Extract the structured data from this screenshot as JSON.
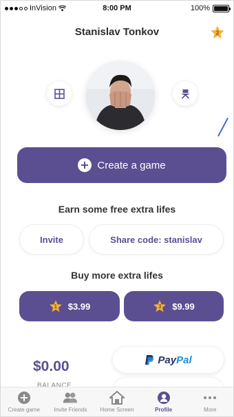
{
  "status_bar": {
    "carrier": "InVision",
    "time": "8:00 PM",
    "battery": "100%"
  },
  "header": {
    "title": "Stanislav Tonkov",
    "star_count": "2"
  },
  "actions": {
    "create_game_label": "Create a game"
  },
  "earn": {
    "title": "Earn some free extra lifes",
    "invite_label": "Invite",
    "share_code_label": "Share code: stanislav"
  },
  "buy": {
    "title": "Buy more extra lifes",
    "options": [
      {
        "badge": "1",
        "price": "$3.99"
      },
      {
        "badge": "3",
        "price": "$9.99"
      }
    ]
  },
  "wallet": {
    "balance": "$0.00",
    "balance_label": "BALANCE",
    "paypal_label_1": "Pay",
    "paypal_label_2": "Pal"
  },
  "tabs": [
    {
      "label": "Create game",
      "icon": "plus-circle-icon"
    },
    {
      "label": "Invite Friends",
      "icon": "users-icon"
    },
    {
      "label": "Home Screen",
      "icon": "home-icon"
    },
    {
      "label": "Profile",
      "icon": "profile-icon",
      "active": true
    },
    {
      "label": "More",
      "icon": "more-icon"
    }
  ],
  "colors": {
    "accent": "#5b4f92",
    "star": "#f5b03a",
    "paypal_dark": "#22346e",
    "paypal_light": "#1f8fd6"
  }
}
